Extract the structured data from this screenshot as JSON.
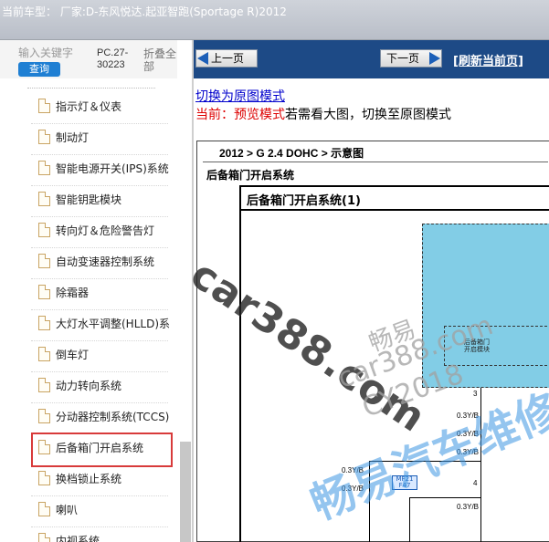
{
  "titlebar": {
    "title": "当前车型：  厂家:D-东风悦达.起亚智跑(Sportage R)2012"
  },
  "sidebar": {
    "search_placeholder": "输入关键字",
    "query_label": "查询",
    "pc_number": "PC.27-30223",
    "collapse_label": "折叠全部",
    "items": [
      {
        "label": "指示灯＆仪表"
      },
      {
        "label": "制动灯"
      },
      {
        "label": "智能电源开关(IPS)系统"
      },
      {
        "label": "智能钥匙模块"
      },
      {
        "label": "转向灯＆危险警告灯"
      },
      {
        "label": "自动变速器控制系统"
      },
      {
        "label": "除霜器"
      },
      {
        "label": "大灯水平调整(HLLD)系"
      },
      {
        "label": "倒车灯"
      },
      {
        "label": "动力转向系统"
      },
      {
        "label": "分动器控制系统(TCCS)"
      },
      {
        "label": "后备箱门开启系统",
        "selected": true
      },
      {
        "label": "换档锁止系统"
      },
      {
        "label": "喇叭"
      },
      {
        "label": "内视系统"
      }
    ]
  },
  "nav": {
    "prev_label": "上一页",
    "next_label": "下一页",
    "refresh_label": "[刷新当前页]"
  },
  "viewer": {
    "mode_link": "切换为原图模式",
    "status_prefix": "当前：",
    "status_mode": "预览模式",
    "status_rest": "若需看大图，切换至原图模式"
  },
  "document": {
    "breadcrumb": "2012 > G 2.4 DOHC > 示意图",
    "system_title": "后备箱门开启系统",
    "diagram_title": "后备箱门开启系统(1)",
    "module_label": "后备箱门\n开启模块",
    "wire_labels": [
      "3",
      "0.3Y/B",
      "0.3Y/B",
      "0.3Y/B",
      "0.3Y/B",
      "0.3Y/B",
      "0.3Y/B",
      "4"
    ],
    "connector_label": "MF21 F47"
  },
  "watermarks": [
    "car388.com",
    "畅易",
    "car388.com",
    "CY2018",
    "畅易汽车维修平台"
  ],
  "colors": {
    "titlebar_text": "#ffffff",
    "nav_bar": "#1d4a86",
    "query_button": "#1f7fd3",
    "selected_outline": "#d83a3a",
    "status_red": "#dd0000",
    "link_blue": "#0000cc",
    "diagram_fill": "#82cde6"
  }
}
